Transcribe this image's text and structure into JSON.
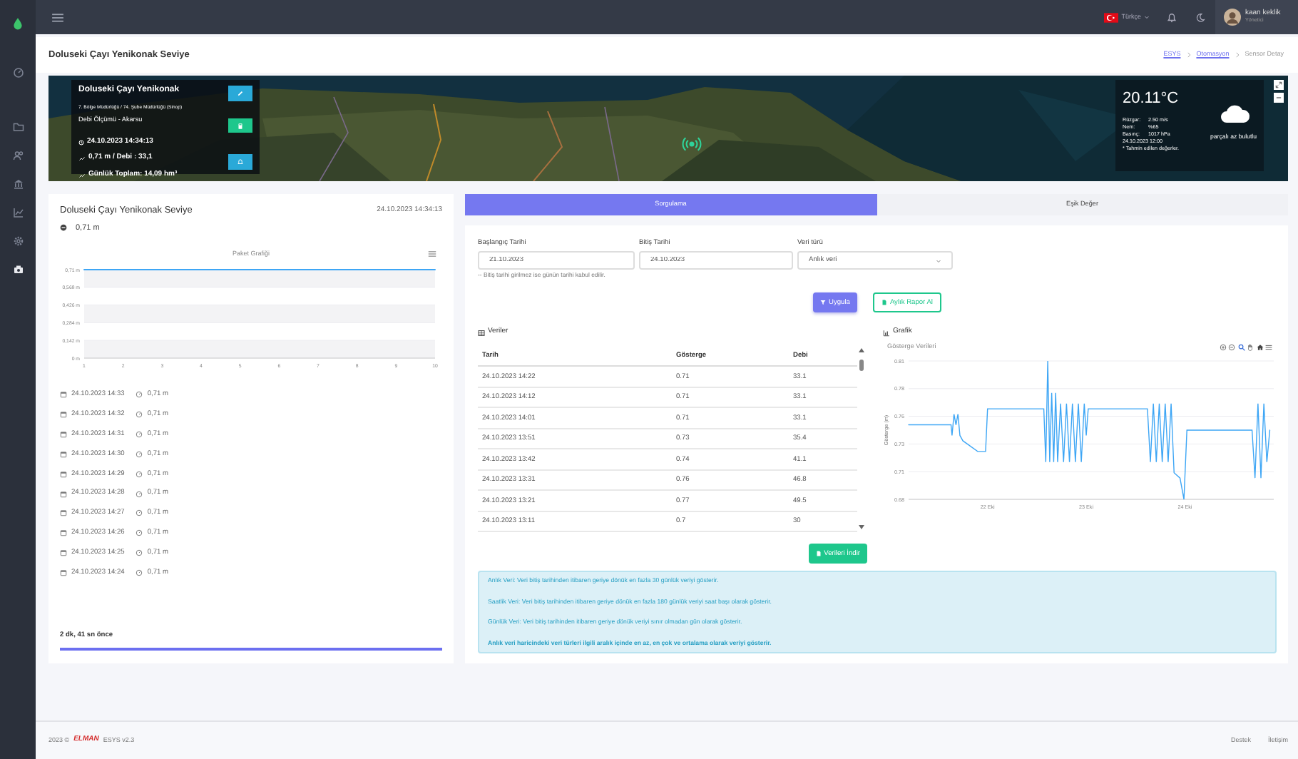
{
  "sidebar": {
    "items": [
      {
        "kind": "dashboard",
        "selected": false
      },
      {
        "kind": "folder",
        "selected": false
      },
      {
        "kind": "users",
        "selected": false
      },
      {
        "kind": "building",
        "selected": false
      },
      {
        "kind": "chart",
        "selected": false
      },
      {
        "kind": "settings",
        "selected": false
      },
      {
        "kind": "device",
        "selected": true
      }
    ]
  },
  "topbar": {
    "language": "Türkçe",
    "user": {
      "name": "kaan keklik",
      "role": "Yönetici"
    }
  },
  "page_header": {
    "title": "Doluseki Çayı Yenikonak Seviye",
    "breadcrumb": [
      {
        "label": "ESYS",
        "selected": false
      },
      {
        "label": "Otomasyon",
        "selected": false
      },
      {
        "label": "Sensor Detay",
        "selected": true
      }
    ]
  },
  "map": {
    "station": {
      "name": "Doluseki Çayı Yenikonak",
      "region": "7. Bölge Müdürlüğü / 74. Şube Müdürlüğü (Sinop)",
      "type": "Debi Ölçümü - Akarsu",
      "timestamp": "24.10.2023 14:34:13",
      "reading": "0,71 m / Debi : 33,1",
      "daily_total": "Günlük Toplam: 14,09 hm³"
    },
    "weather": {
      "temperature": "20.11°C",
      "rows": [
        {
          "label": "Rüzgar:",
          "value": "2.50 m/s"
        },
        {
          "label": "Nem:",
          "value": "%65"
        },
        {
          "label": "Basınç:",
          "value": "1017 hPa"
        }
      ],
      "time": "24.10.2023 12:00",
      "note": "* Tahmin edilen değerler.",
      "condition": "parçalı az bulutlu"
    }
  },
  "level_card": {
    "title": "Doluseki Çayı Yenikonak Seviye",
    "timestamp": "24.10.2023 14:34:13",
    "current": "0,71 m",
    "chart_data": {
      "type": "line",
      "title": "Paket Grafiği",
      "categories": [
        "1",
        "2",
        "3",
        "4",
        "5",
        "6",
        "7",
        "8",
        "9",
        "10"
      ],
      "values": [
        0.71,
        0.71,
        0.71,
        0.71,
        0.71,
        0.71,
        0.71,
        0.71,
        0.71,
        0.71
      ],
      "ylim": [
        0,
        0.71
      ],
      "grid": true,
      "yticks": [
        {
          "value": 0,
          "label": "0 m"
        },
        {
          "value": 0.142,
          "label": "0,142 m"
        },
        {
          "value": 0.284,
          "label": "0,284 m"
        },
        {
          "value": 0.426,
          "label": "0,426 m"
        },
        {
          "value": 0.568,
          "label": "0,568 m"
        },
        {
          "value": 0.71,
          "label": "0,71 m"
        }
      ]
    },
    "history": [
      {
        "time": "24.10.2023 14:33",
        "value": "0,71 m"
      },
      {
        "time": "24.10.2023 14:32",
        "value": "0,71 m"
      },
      {
        "time": "24.10.2023 14:31",
        "value": "0,71 m"
      },
      {
        "time": "24.10.2023 14:30",
        "value": "0,71 m"
      },
      {
        "time": "24.10.2023 14:29",
        "value": "0,71 m"
      },
      {
        "time": "24.10.2023 14:28",
        "value": "0,71 m"
      },
      {
        "time": "24.10.2023 14:27",
        "value": "0,71 m"
      },
      {
        "time": "24.10.2023 14:26",
        "value": "0,71 m"
      },
      {
        "time": "24.10.2023 14:25",
        "value": "0,71 m"
      },
      {
        "time": "24.10.2023 14:24",
        "value": "0,71 m"
      }
    ],
    "updated": "2 dk, 41 sn önce",
    "progress": {
      "level": 1
    }
  },
  "query": {
    "tabs": [
      {
        "label": "Sorgulama",
        "selected": true
      },
      {
        "label": "Eşik Değer",
        "selected": false
      }
    ],
    "form": {
      "fields": [
        {
          "label": "Başlangıç Tarihi",
          "value": "21.10.2023",
          "kind": "input"
        },
        {
          "label": "Bitiş Tarihi",
          "value": "24.10.2023",
          "kind": "input"
        },
        {
          "label": "Veri türü",
          "value": "Anlık veri",
          "kind": "select"
        }
      ],
      "hint": "-- Bitiş tarihi girilmez ise günün tarihi kabul edilir.",
      "buttons": [
        {
          "label": "Uygula",
          "kind": "primary"
        },
        {
          "label": "Aylık Rapor Al",
          "kind": "outline"
        }
      ]
    },
    "table": {
      "title": "Veriler",
      "columns": [
        "Tarih",
        "Gösterge",
        "Debi"
      ],
      "rows": [
        [
          "24.10.2023 14:22",
          "0.71",
          "33.1"
        ],
        [
          "24.10.2023 14:12",
          "0.71",
          "33.1"
        ],
        [
          "24.10.2023 14:01",
          "0.71",
          "33.1"
        ],
        [
          "24.10.2023 13:51",
          "0.73",
          "35.4"
        ],
        [
          "24.10.2023 13:42",
          "0.74",
          "41.1"
        ],
        [
          "24.10.2023 13:31",
          "0.76",
          "46.8"
        ],
        [
          "24.10.2023 13:21",
          "0.77",
          "49.5"
        ],
        [
          "24.10.2023 13:11",
          "0.7",
          "30"
        ]
      ]
    },
    "download_button": "Verileri İndir",
    "chart": {
      "title": "Grafik",
      "chart_data": {
        "type": "line",
        "title": "Gösterge Verileri",
        "ylabel": "Gösterge (m)",
        "x": [
          21.2,
          21.63,
          21.64,
          21.66,
          21.68,
          21.7,
          21.72,
          21.75,
          21.9,
          21.98,
          22.0,
          22.57,
          22.59,
          22.61,
          22.63,
          22.65,
          22.67,
          22.69,
          22.71,
          22.74,
          22.77,
          22.8,
          22.83,
          22.86,
          22.89,
          22.92,
          22.95,
          22.98,
          23.0,
          23.02,
          23.62,
          23.65,
          23.68,
          23.71,
          23.74,
          23.77,
          23.8,
          23.83,
          23.86,
          23.89,
          23.95,
          23.99,
          24.02,
          24.68,
          24.71,
          24.74,
          24.77,
          24.8,
          24.83,
          24.86
        ],
        "values": [
          0.75,
          0.75,
          0.74,
          0.76,
          0.75,
          0.76,
          0.74,
          0.735,
          0.725,
          0.725,
          0.765,
          0.765,
          0.715,
          0.81,
          0.715,
          0.78,
          0.715,
          0.78,
          0.715,
          0.77,
          0.715,
          0.77,
          0.715,
          0.77,
          0.715,
          0.77,
          0.715,
          0.77,
          0.74,
          0.765,
          0.765,
          0.715,
          0.77,
          0.715,
          0.77,
          0.715,
          0.77,
          0.715,
          0.77,
          0.705,
          0.7,
          0.68,
          0.745,
          0.745,
          0.7,
          0.77,
          0.7,
          0.77,
          0.715,
          0.745
        ],
        "xlim": [
          21.2,
          24.9
        ],
        "ylim": [
          0.68,
          0.81
        ],
        "grid": true,
        "xticks": [
          {
            "value": 22,
            "label": "22 Eki"
          },
          {
            "value": 23,
            "label": "23 Eki"
          },
          {
            "value": 24,
            "label": "24 Eki"
          }
        ],
        "yticks": [
          {
            "value": 0.68,
            "label": "0.68"
          },
          {
            "value": 0.706,
            "label": "0.71"
          },
          {
            "value": 0.732,
            "label": "0.73"
          },
          {
            "value": 0.758,
            "label": "0.76"
          },
          {
            "value": 0.784,
            "label": "0.78"
          },
          {
            "value": 0.81,
            "label": "0.81"
          }
        ]
      }
    },
    "info": [
      {
        "text": "Anlık Veri: Veri bitiş tarihinden itibaren geriye dönük en fazla 30 günlük veriyi gösterir.",
        "bold": false
      },
      {
        "text": "Saatlik Veri: Veri bitiş tarihinden itibaren geriye dönük en fazla 180 günlük veriyi saat başı olarak gösterir.",
        "bold": false
      },
      {
        "text": "Günlük Veri: Veri bitiş tarihinden itibaren geriye dönük veriyi sınır olmadan gün olarak gösterir.",
        "bold": false
      },
      {
        "text": "Anlık veri haricindeki veri türleri ilgili aralık içinde en az, en çok ve ortalama olarak veriyi gösterir.",
        "bold": true
      }
    ]
  },
  "footer": {
    "copyright": "2023 ©",
    "brand": "ELMAN",
    "product": "ESYS v2.3",
    "links": [
      "Destek",
      "İletişim"
    ]
  }
}
